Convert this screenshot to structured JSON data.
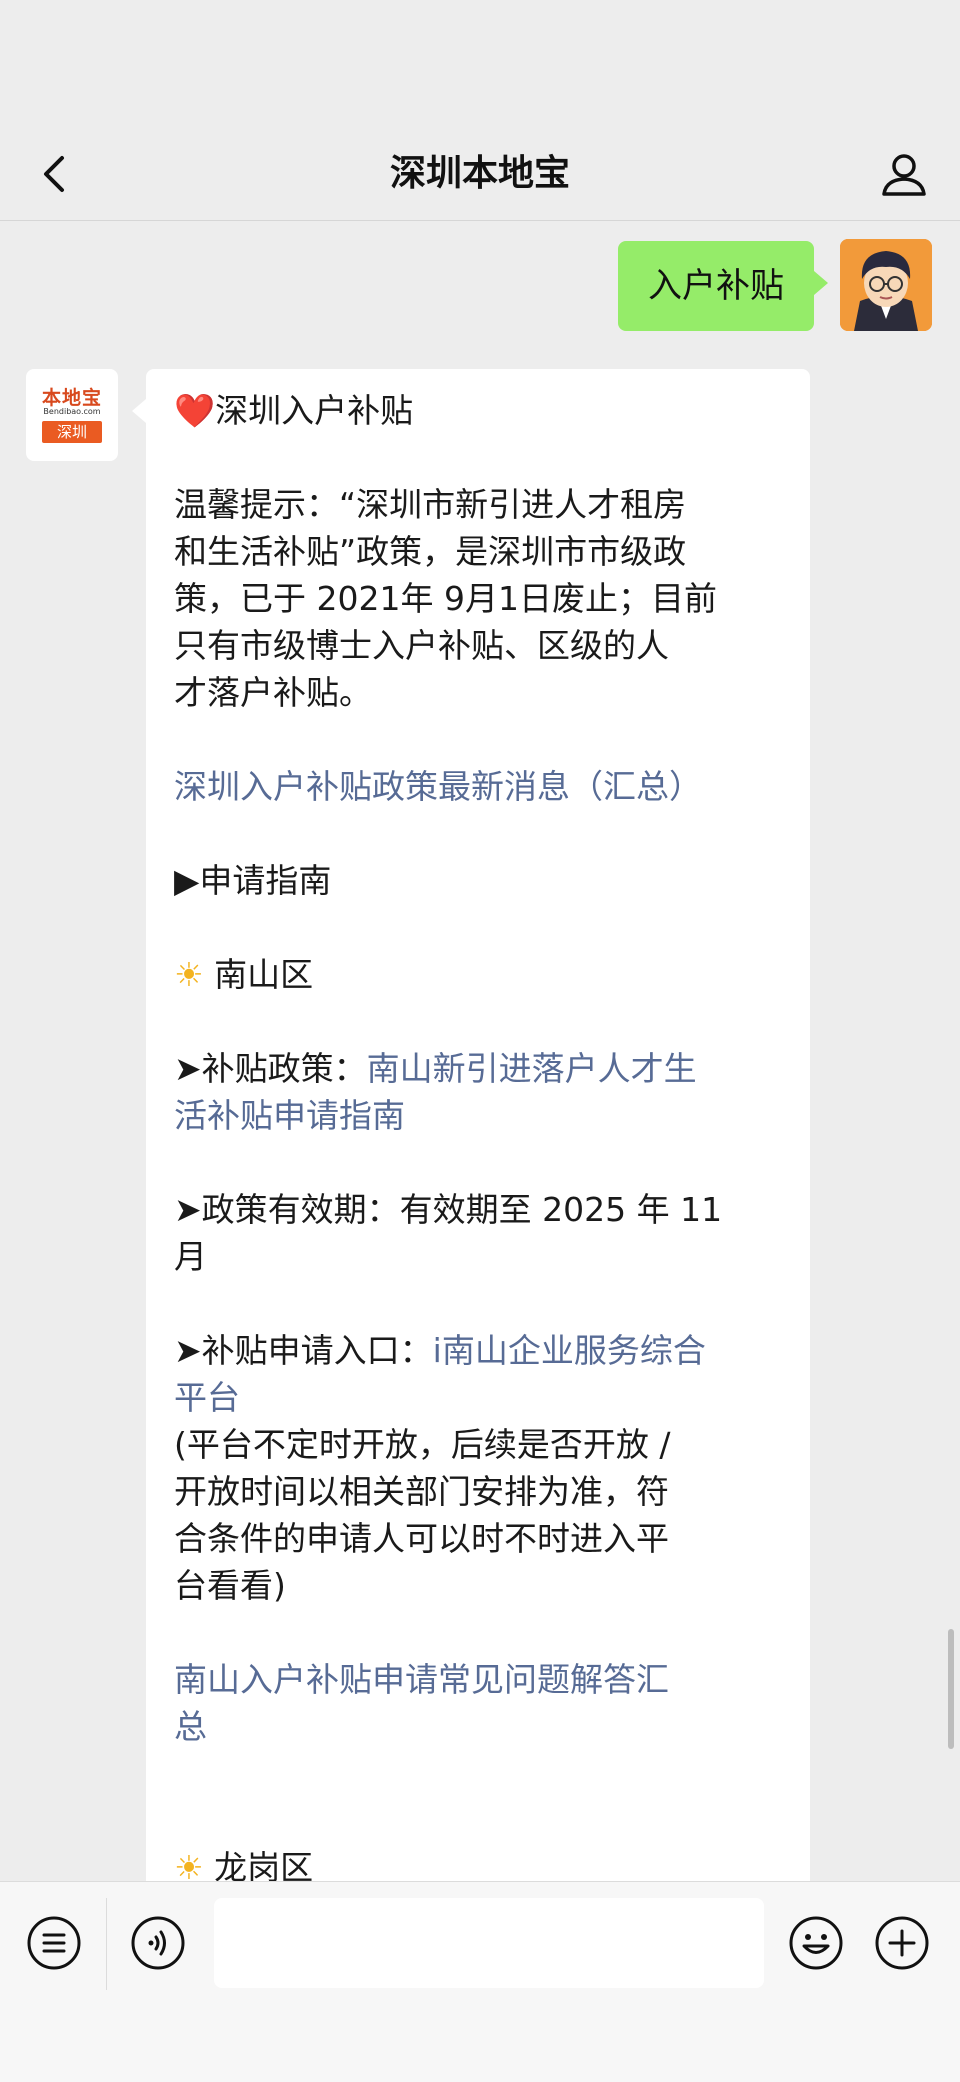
{
  "header": {
    "title": "深圳本地宝",
    "back_icon": "chevron-left-icon",
    "profile_icon": "person-icon"
  },
  "messages": {
    "outgoing": {
      "text": "入户补贴",
      "bubble_color": "#95ec69"
    },
    "incoming": {
      "avatar": {
        "logo_text": "本地宝",
        "logo_sub": "Bendibao.com",
        "logo_city": "深圳"
      },
      "heading_emoji": "❤️",
      "heading": "深圳入户补贴",
      "tip_lines": [
        "温馨提示：“深圳市新引进人才租房",
        "和生活补贴”政策，是深圳市市级政",
        "策，已于 2021年 9月1日废止；目前",
        "只有市级博士入户补贴、区级的人",
        "才落户补贴。"
      ],
      "summary_link": "深圳入户补贴政策最新消息（汇总）",
      "guide_heading": "▶申请指南",
      "district1_emoji": "☀",
      "district1": "南山区",
      "policy_label": "➤补贴政策：",
      "policy_link_line1": "南山新引进落户人才生",
      "policy_link_line2": "活补贴申请指南",
      "validity_line1": "➤政策有效期：有效期至 2025 年 11",
      "validity_line2": "月",
      "entry_label": "➤补贴申请入口：",
      "entry_link_line1": "i南山企业服务综合",
      "entry_link_line2": "平台",
      "entry_note_lines": [
        "(平台不定时开放，后续是否开放 /",
        "开放时间以相关部门安排为准，符",
        "合条件的申请人可以时不时进入平",
        "台看看)"
      ],
      "faq_link_line1": "南山入户补贴申请常见问题解答汇",
      "faq_link_line2": "总",
      "district2_emoji": "☀",
      "district2": "龙岗区"
    }
  },
  "input_bar": {
    "menu_icon": "menu-list-icon",
    "voice_icon": "voice-icon",
    "input_value": "",
    "emoji_icon": "emoji-icon",
    "plus_icon": "plus-icon"
  },
  "colors": {
    "background": "#ededed",
    "link": "#576b95",
    "brand_orange": "#ea5b22"
  }
}
